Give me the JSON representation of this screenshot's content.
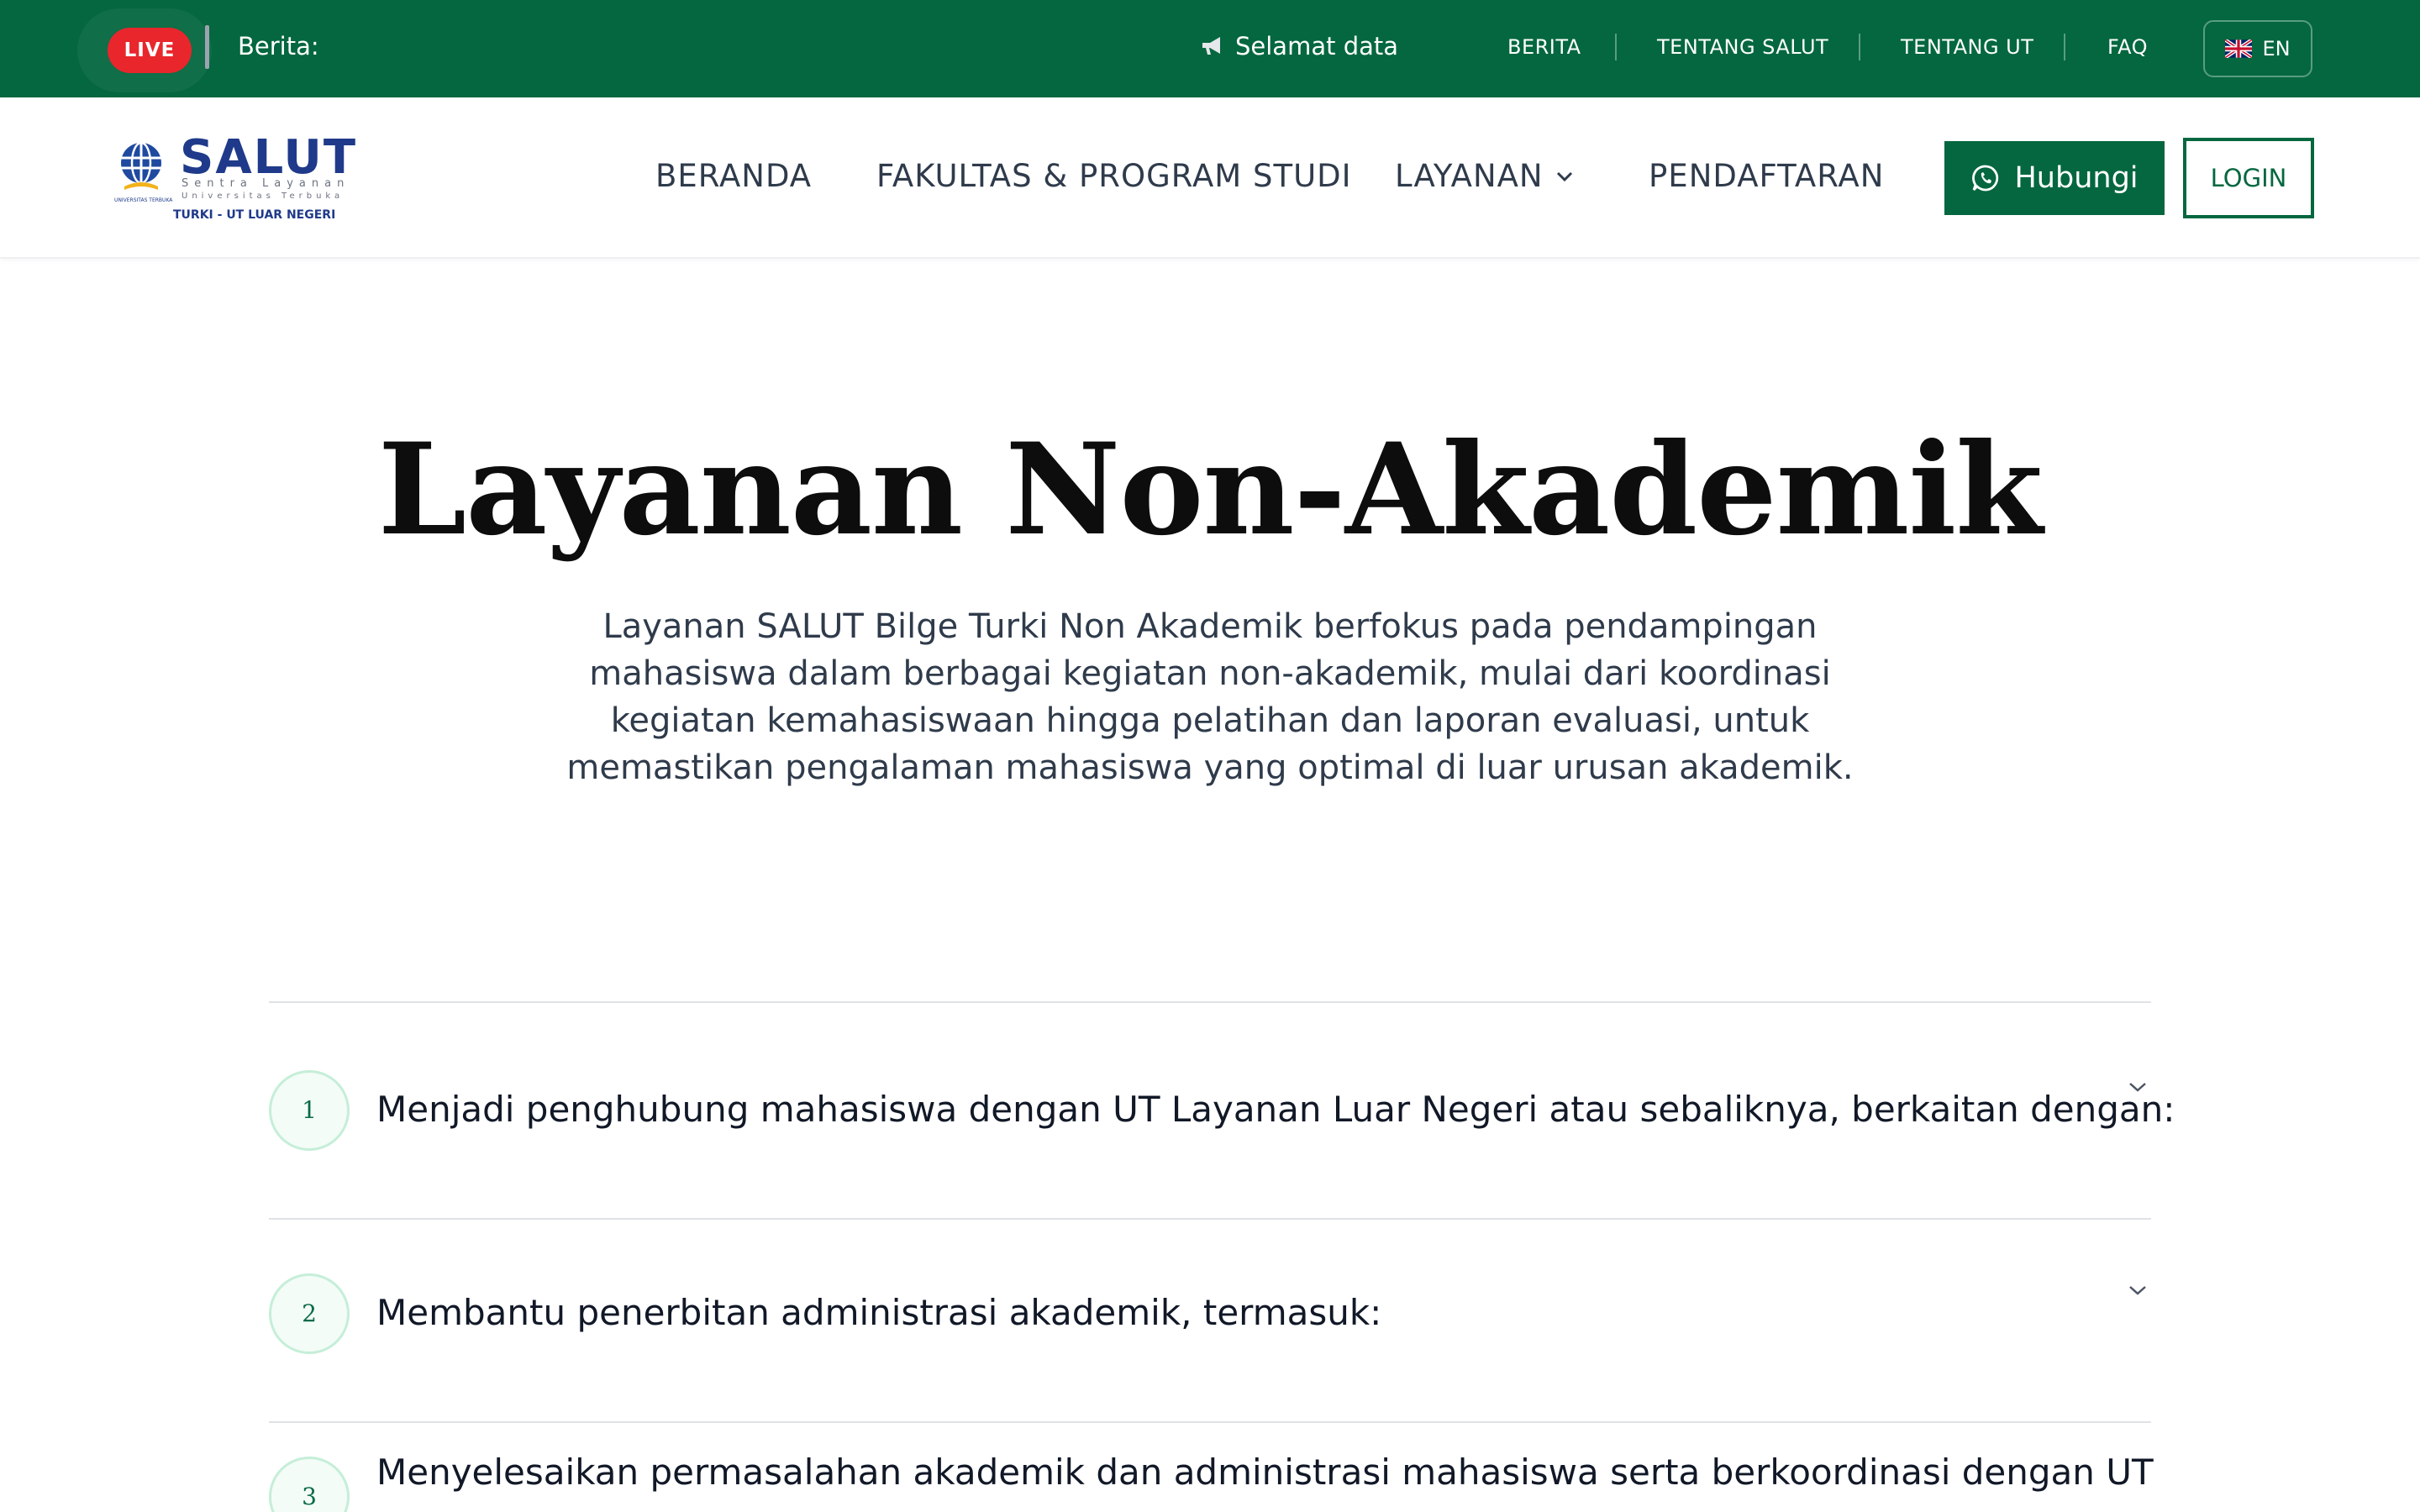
{
  "topbar": {
    "live_label": "LIVE",
    "news_label": "Berita:",
    "ticker_text": "Selamat data",
    "links": [
      "BERITA",
      "TENTANG SALUT",
      "TENTANG UT",
      "FAQ"
    ],
    "lang_label": "EN",
    "bg_color": "#04673f",
    "live_color": "#e8262c"
  },
  "logo": {
    "wordmark": "SALUT",
    "tagline1": "Sentra Layanan",
    "tagline2": "Universitas Terbuka",
    "subtitle": "TURKI - UT LUAR NEGERI",
    "org": "UNIVERSITAS TERBUKA"
  },
  "nav": {
    "items": [
      "BERANDA",
      "FAKULTAS & PROGRAM STUDI",
      "LAYANAN",
      "PENDAFTARAN"
    ],
    "contact_label": "Hubungi",
    "login_label": "LOGIN"
  },
  "hero": {
    "title": "Layanan Non-Akademik",
    "description": "Layanan SALUT Bilge Turki Non Akademik berfokus pada pendampingan mahasiswa dalam berbagai kegiatan non-akademik, mulai dari koordinasi kegiatan kemahasiswaan hingga pelatihan dan laporan evaluasi, untuk memastikan pengalaman mahasiswa yang optimal di luar urusan akademik."
  },
  "accordion": [
    {
      "num": "1",
      "text": "Menjadi penghubung mahasiswa dengan UT Layanan Luar Negeri atau sebaliknya, berkaitan dengan:"
    },
    {
      "num": "2",
      "text": "Membantu penerbitan administrasi akademik, termasuk:"
    },
    {
      "num": "3",
      "text": "Menyelesaikan permasalahan akademik dan administrasi mahasiswa serta berkoordinasi dengan UT"
    }
  ]
}
